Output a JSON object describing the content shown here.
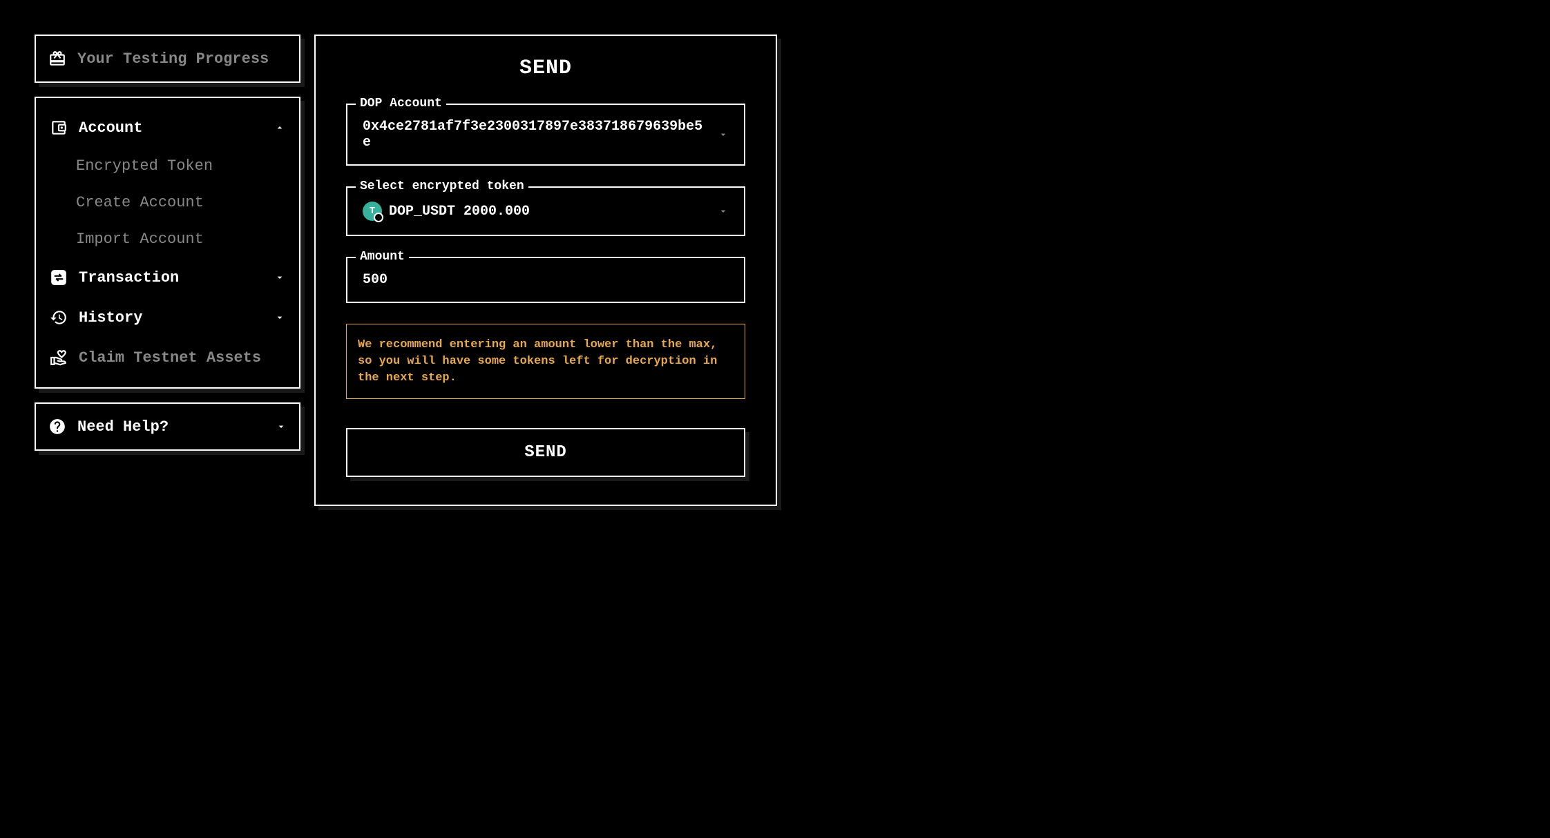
{
  "sidebar": {
    "progress": {
      "label": "Your Testing Progress"
    },
    "nav": {
      "account": {
        "label": "Account",
        "expanded": true,
        "items": [
          {
            "label": "Encrypted Token"
          },
          {
            "label": "Create Account"
          },
          {
            "label": "Import Account"
          }
        ]
      },
      "transaction": {
        "label": "Transaction",
        "expanded": false
      },
      "history": {
        "label": "History",
        "expanded": false
      },
      "claim": {
        "label": "Claim Testnet Assets"
      }
    },
    "help": {
      "label": "Need Help?"
    }
  },
  "main": {
    "title": "SEND",
    "account_field": {
      "legend": "DOP Account",
      "value": "0x4ce2781af7f3e2300317897e383718679639be5e"
    },
    "token_field": {
      "legend": "Select encrypted token",
      "value": "DOP_USDT 2000.000"
    },
    "amount_field": {
      "legend": "Amount",
      "value": "500"
    },
    "warning": "We recommend entering an amount lower than the max, so you will have some tokens left for decryption in the next step.",
    "send_button": "SEND"
  }
}
